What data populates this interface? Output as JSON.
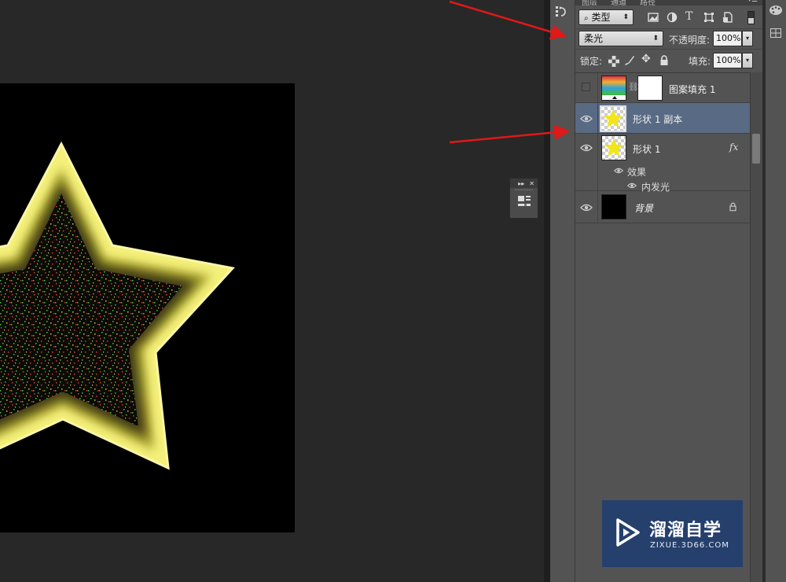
{
  "colors": {
    "panel_bg": "#535353",
    "workspace_bg": "#282828",
    "selected_row": "#596a84",
    "star_glow": "#f4f07a",
    "arrow": "#e01818",
    "watermark_bg": "#26406d"
  },
  "panel_tabs": [
    "图层",
    "通道",
    "路径"
  ],
  "filter": {
    "kind_label": "类型",
    "icons": [
      "image-filter-icon",
      "adjustment-filter-icon",
      "type-filter-icon",
      "shape-filter-icon",
      "smart-object-filter-icon",
      "filter-toggle-icon"
    ]
  },
  "blend": {
    "mode": "柔光",
    "opacity_label": "不透明度:",
    "opacity_value": "100%"
  },
  "lock": {
    "label": "锁定:",
    "fill_label": "填充:",
    "fill_value": "100%"
  },
  "layers": [
    {
      "name": "图案填充 1",
      "visible": false,
      "selected": false
    },
    {
      "name": "形状 1 副本",
      "visible": true,
      "selected": true
    },
    {
      "name": "形状 1",
      "visible": true,
      "selected": false,
      "fx": "fx",
      "effects_label": "效果",
      "effect": "内发光"
    },
    {
      "name": "背景",
      "visible": true,
      "selected": false,
      "locked": true
    }
  ],
  "watermark": {
    "title": "溜溜自学",
    "url": "ZIXUE.3D66.COM"
  }
}
